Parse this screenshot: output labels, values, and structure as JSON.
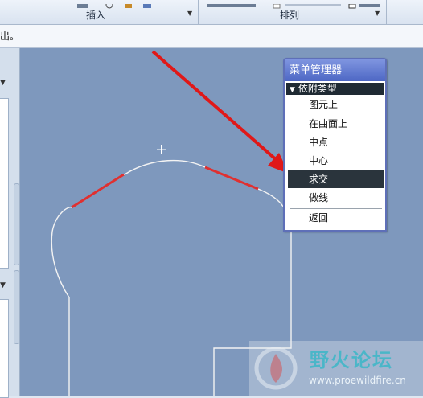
{
  "ribbon": {
    "group_insert_label": "插入",
    "group_arrange_label": "排列"
  },
  "message": {
    "text": "出。"
  },
  "menu_manager": {
    "title": "菜单管理器",
    "section_label": "依附类型",
    "items": [
      {
        "label": "图元上",
        "selected": false
      },
      {
        "label": "在曲面上",
        "selected": false
      },
      {
        "label": "中点",
        "selected": false
      },
      {
        "label": "中心",
        "selected": false
      },
      {
        "label": "求交",
        "selected": true
      },
      {
        "label": "做线",
        "selected": false
      },
      {
        "label": "返回",
        "selected": false
      }
    ]
  },
  "watermark": {
    "site_name": "野火论坛",
    "url": "www.proewildfire.cn"
  },
  "colors": {
    "canvas_background": "#7e98bd",
    "annotation_arrow": "#e01818",
    "highlight_edge": "#e03030",
    "menu_title": "#4d67c4",
    "menu_selected": "#2a343c"
  },
  "icons": {
    "section_toggle": "triangle-down-icon",
    "cursor": "crosshair-icon"
  }
}
